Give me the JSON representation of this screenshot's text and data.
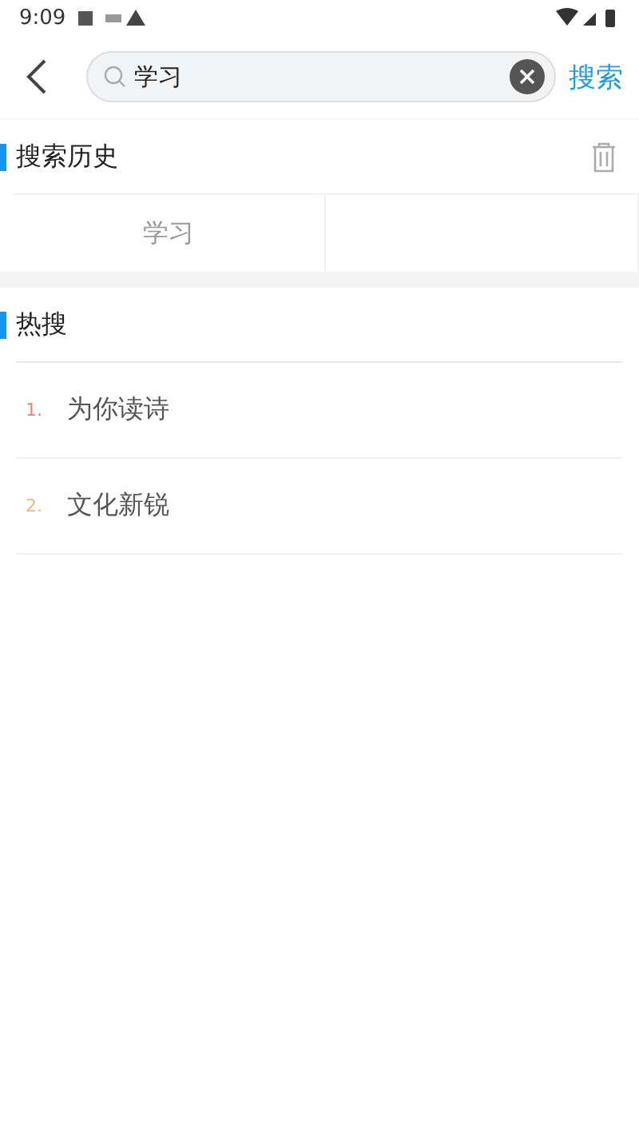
{
  "status_bar": {
    "time": "9:09"
  },
  "search": {
    "value": "学习",
    "button": "搜索"
  },
  "history": {
    "title": "搜索历史",
    "items": [
      "学习"
    ]
  },
  "hot": {
    "title": "热搜",
    "items": [
      {
        "rank": "1.",
        "text": "为你读诗",
        "color": "#e88080"
      },
      {
        "rank": "2.",
        "text": "文化新锐",
        "color": "#f0b872"
      }
    ]
  }
}
